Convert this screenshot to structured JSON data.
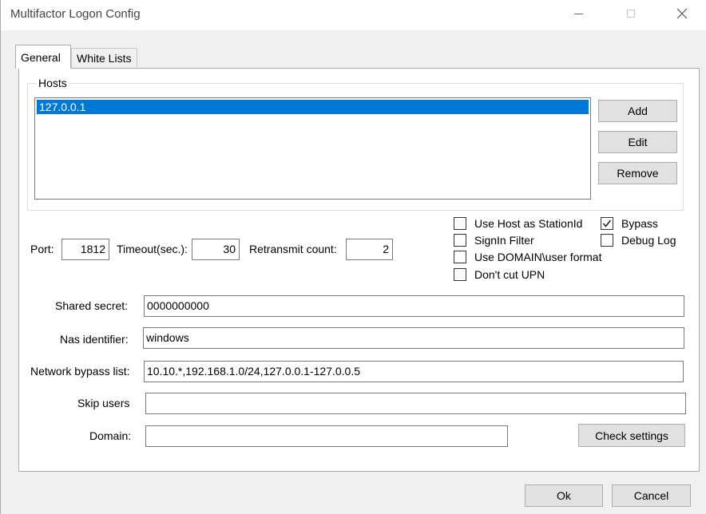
{
  "window": {
    "title": "Multifactor Logon Config",
    "icons": {
      "minimize": "minimize-icon",
      "maximize": "maximize-icon",
      "close": "close-icon"
    }
  },
  "tabs": [
    {
      "label": "General",
      "selected": true
    },
    {
      "label": "White Lists",
      "selected": false
    }
  ],
  "hosts": {
    "group_label": "Hosts",
    "items": [
      {
        "value": "127.0.0.1",
        "selected": true
      }
    ],
    "buttons": {
      "add": "Add",
      "edit": "Edit",
      "remove": "Remove"
    }
  },
  "settings": {
    "port": {
      "label": "Port:",
      "value": "1812"
    },
    "timeout": {
      "label": "Timeout(sec.):",
      "value": "30"
    },
    "retransmit": {
      "label": "Retransmit count:",
      "value": "2"
    }
  },
  "checkboxes": [
    {
      "key": "use_host",
      "label": "Use Host as StationId",
      "checked": false
    },
    {
      "key": "signin_filter",
      "label": "SignIn Filter",
      "checked": false
    },
    {
      "key": "use_domain",
      "label": "Use DOMAIN\\user format",
      "checked": false
    },
    {
      "key": "dont_cut_upn",
      "label": "Don't cut UPN",
      "checked": false
    },
    {
      "key": "bypass",
      "label": "Bypass",
      "checked": true
    },
    {
      "key": "debug_log",
      "label": "Debug Log",
      "checked": false
    }
  ],
  "fields": {
    "shared_secret": {
      "label": "Shared secret:",
      "value": "0000000000"
    },
    "nas_identifier": {
      "label": "Nas identifier:",
      "value": "windows"
    },
    "network_bypass": {
      "label": "Network bypass list:",
      "value": "10.10.*,192.168.1.0/24,127.0.0.1-127.0.0.5"
    },
    "skip_users": {
      "label": "Skip users",
      "value": ""
    },
    "domain": {
      "label": "Domain:",
      "value": ""
    }
  },
  "buttons": {
    "check_settings": "Check settings",
    "ok": "Ok",
    "cancel": "Cancel"
  }
}
